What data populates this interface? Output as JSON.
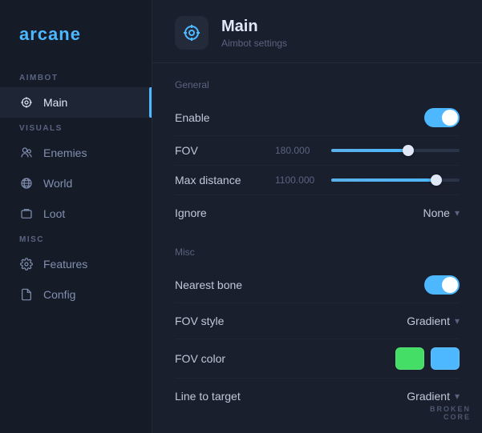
{
  "app": {
    "logo": "arcane"
  },
  "sidebar": {
    "sections": [
      {
        "label": "AIMBOT",
        "items": [
          {
            "id": "main",
            "label": "Main",
            "icon": "crosshair",
            "active": true
          }
        ]
      },
      {
        "label": "VISUALS",
        "items": [
          {
            "id": "enemies",
            "label": "Enemies",
            "icon": "users"
          },
          {
            "id": "world",
            "label": "World",
            "icon": "globe"
          },
          {
            "id": "loot",
            "label": "Loot",
            "icon": "loot"
          }
        ]
      },
      {
        "label": "MISC",
        "items": [
          {
            "id": "features",
            "label": "Features",
            "icon": "gear"
          },
          {
            "id": "config",
            "label": "Config",
            "icon": "file"
          }
        ]
      }
    ]
  },
  "page": {
    "title": "Main",
    "subtitle": "Aimbot settings"
  },
  "settings": {
    "general_label": "General",
    "misc_label": "Misc",
    "rows": [
      {
        "id": "enable",
        "label": "Enable",
        "type": "toggle",
        "value": true
      },
      {
        "id": "fov",
        "label": "FOV",
        "type": "slider",
        "display_value": "180.000",
        "percent": 60
      },
      {
        "id": "max_distance",
        "label": "Max distance",
        "type": "slider",
        "display_value": "1100.000",
        "percent": 82
      },
      {
        "id": "ignore",
        "label": "Ignore",
        "type": "dropdown",
        "value": "None"
      }
    ],
    "misc_rows": [
      {
        "id": "nearest_bone",
        "label": "Nearest bone",
        "type": "toggle",
        "value": true
      },
      {
        "id": "fov_style",
        "label": "FOV style",
        "type": "dropdown",
        "value": "Gradient"
      },
      {
        "id": "fov_color",
        "label": "FOV color",
        "type": "color",
        "colors": [
          "#44dd66",
          "#4db8ff"
        ]
      },
      {
        "id": "line_to_target",
        "label": "Line to target",
        "type": "dropdown",
        "value": "Gradient"
      }
    ]
  },
  "watermark": {
    "line1": "BROKEN",
    "line2": "CORE"
  }
}
